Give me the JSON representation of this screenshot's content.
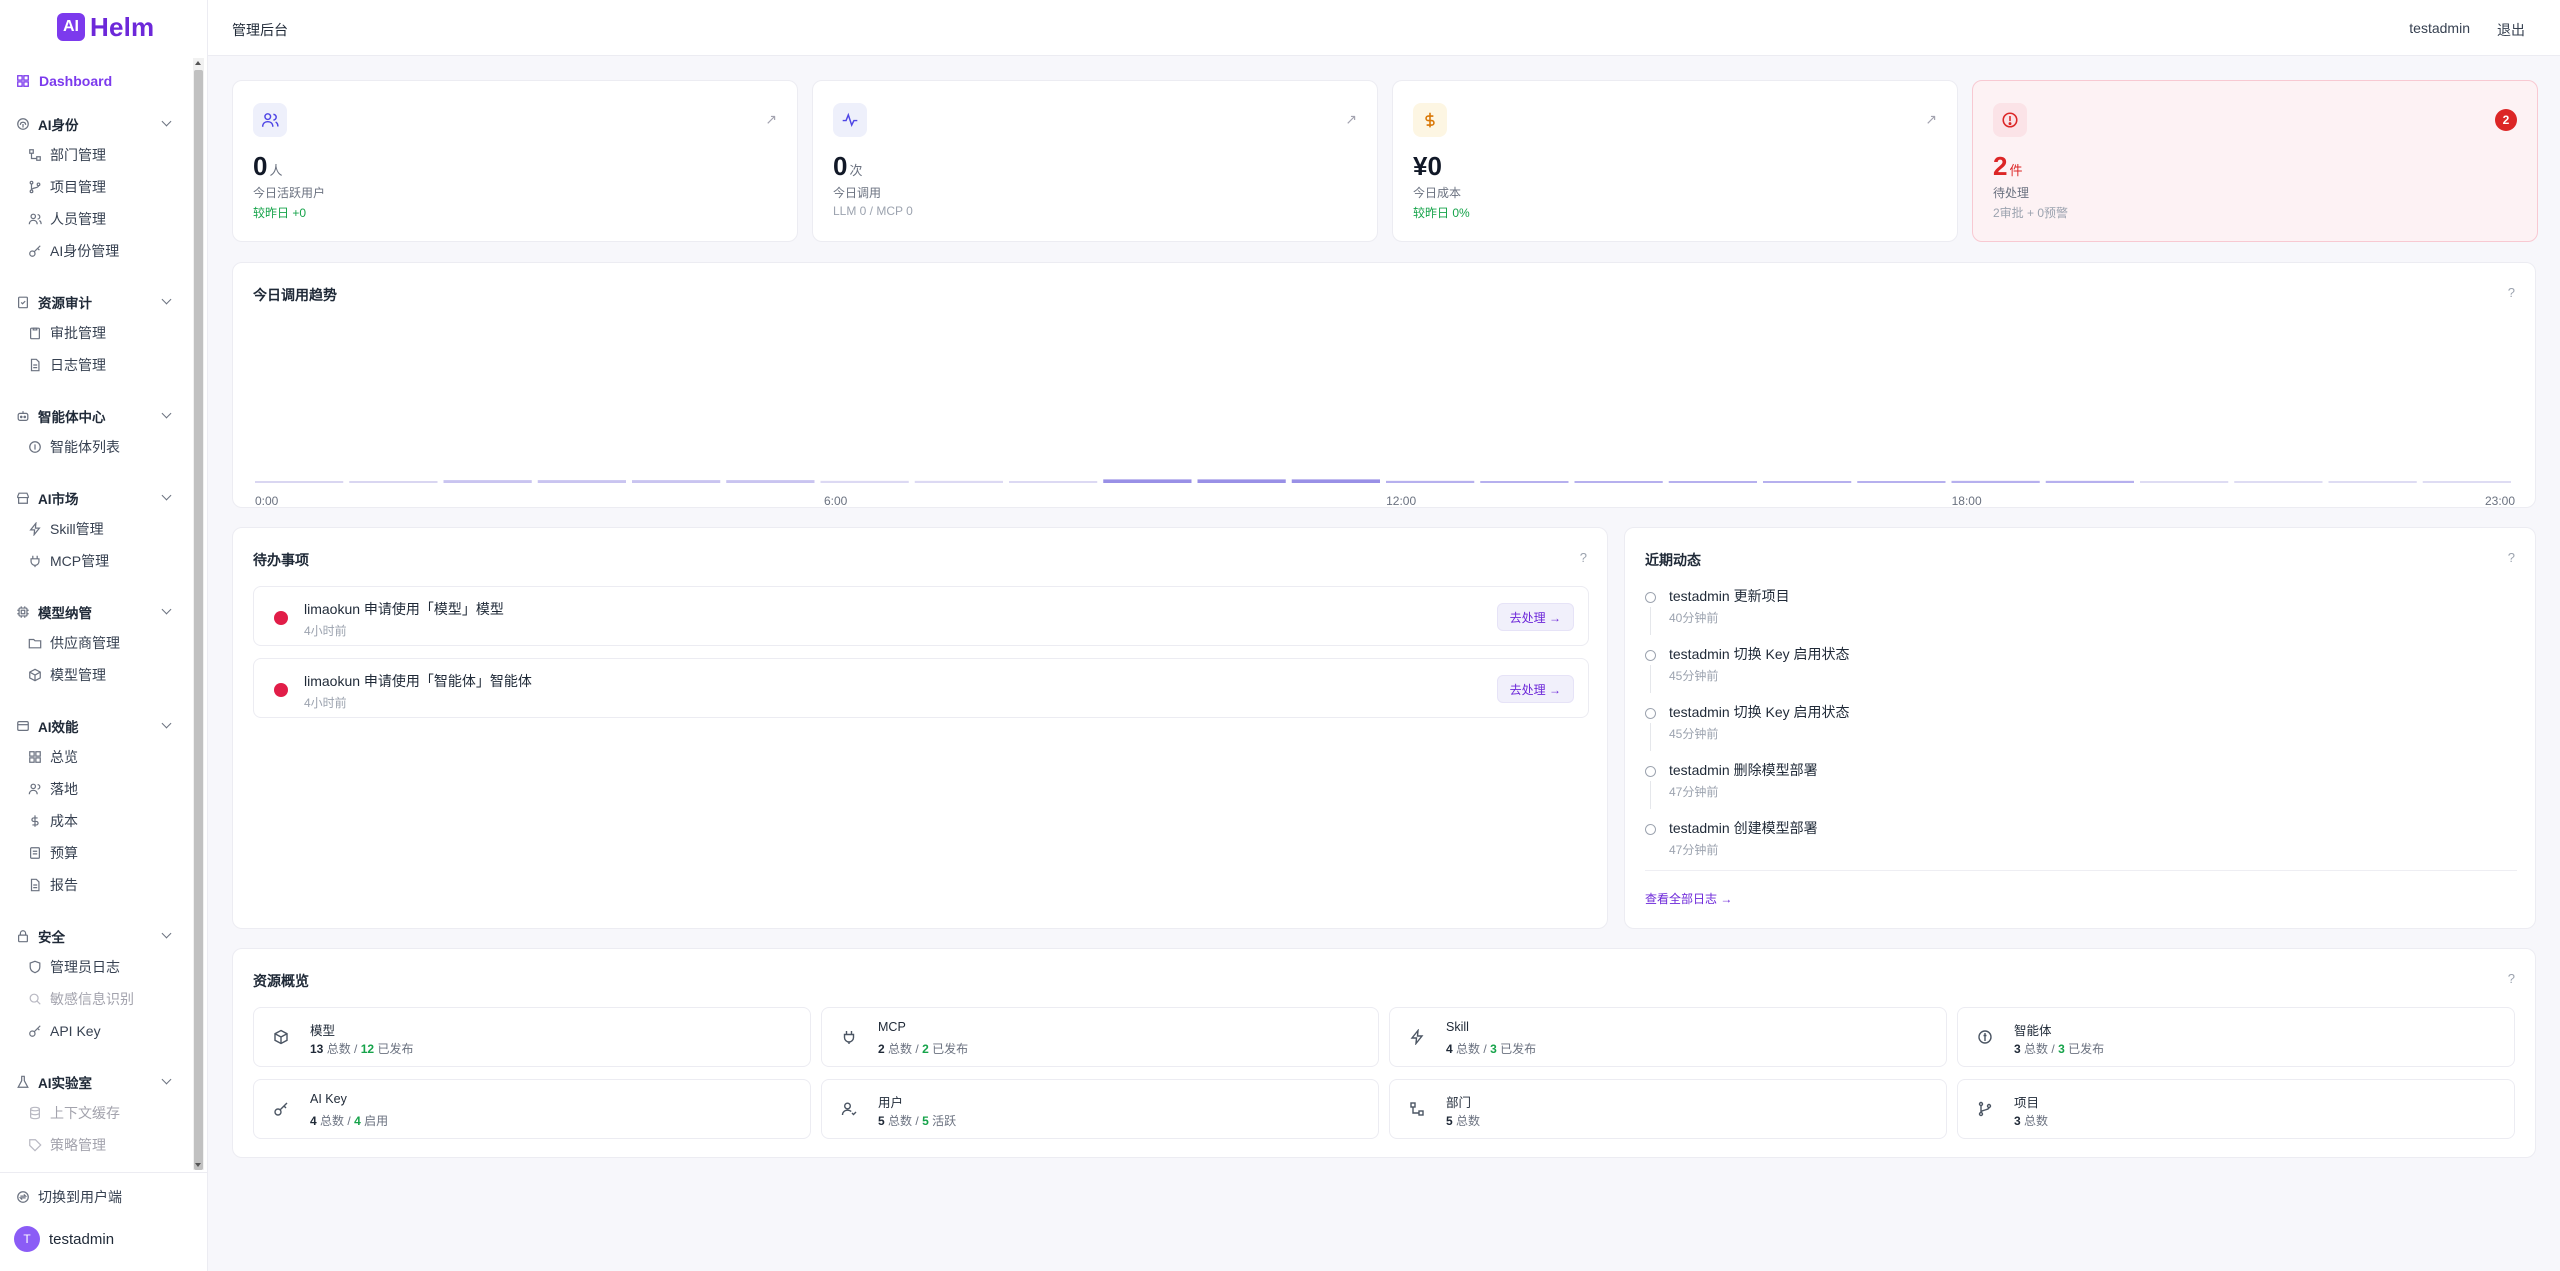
{
  "app": {
    "logo_text": "AI",
    "name": "Helm"
  },
  "header": {
    "title": "管理后台",
    "user": "testadmin",
    "logout": "退出"
  },
  "sidebar": {
    "dashboard": "Dashboard",
    "groups": [
      {
        "title": "AI身份",
        "items": [
          "部门管理",
          "项目管理",
          "人员管理",
          "AI身份管理"
        ]
      },
      {
        "title": "资源审计",
        "items": [
          "审批管理",
          "日志管理"
        ]
      },
      {
        "title": "智能体中心",
        "items": [
          "智能体列表"
        ]
      },
      {
        "title": "AI市场",
        "items": [
          "Skill管理",
          "MCP管理"
        ]
      },
      {
        "title": "模型纳管",
        "items": [
          "供应商管理",
          "模型管理"
        ]
      },
      {
        "title": "AI效能",
        "items": [
          "总览",
          "落地",
          "成本",
          "预算",
          "报告"
        ]
      },
      {
        "title": "安全",
        "items": [
          "管理员日志",
          "敏感信息识别",
          "API Key"
        ]
      },
      {
        "title": "AI实验室",
        "items": [
          "上下文缓存",
          "策略管理"
        ]
      }
    ],
    "switch_user": "切换到用户端",
    "current_user": "testadmin",
    "avatar_letter": "T"
  },
  "stats": [
    {
      "value": "0",
      "unit": "人",
      "label": "今日活跃用户",
      "sub": "较昨日 +0",
      "icon": "users-icon"
    },
    {
      "value": "0",
      "unit": "次",
      "label": "今日调用",
      "sub": "LLM 0 / MCP 0",
      "icon": "activity-icon"
    },
    {
      "value": "¥0",
      "unit": "",
      "label": "今日成本",
      "sub": "较昨日 0%",
      "icon": "dollar-icon"
    },
    {
      "value": "2",
      "unit": "件",
      "label": "待处理",
      "sub": "2审批 + 0预警",
      "badge": "2",
      "icon": "alert-icon"
    }
  ],
  "trend": {
    "title": "今日调用趋势",
    "help": "?"
  },
  "chart_data": {
    "type": "bar",
    "title": "今日调用趋势",
    "categories": [
      "0:00",
      "1:00",
      "2:00",
      "3:00",
      "4:00",
      "5:00",
      "6:00",
      "7:00",
      "8:00",
      "9:00",
      "10:00",
      "11:00",
      "12:00",
      "13:00",
      "14:00",
      "15:00",
      "16:00",
      "17:00",
      "18:00",
      "19:00",
      "20:00",
      "21:00",
      "22:00",
      "23:00"
    ],
    "tick_labels": [
      "0:00",
      "6:00",
      "12:00",
      "18:00",
      "23:00"
    ],
    "values": [
      0.3,
      0.5,
      0.8,
      0.8,
      0.8,
      0.8,
      0.6,
      0.6,
      0.5,
      1.0,
      1.0,
      1.0,
      0.6,
      0.5,
      0.5,
      0.5,
      0.5,
      0.5,
      0.6,
      0.6,
      0.5,
      0.3,
      0.3,
      0.3
    ],
    "ylim": [
      0,
      100
    ],
    "grid": false,
    "colors": [
      "#d6d3f2",
      "#c4bff0",
      "#ddd9f5",
      "#e2e0f3",
      "#a9a2ea",
      "#8f86e4",
      "#b4aeea"
    ]
  },
  "todo": {
    "title": "待办事项",
    "help": "?",
    "items": [
      {
        "title": "limaokun 申请使用「模型」模型",
        "time": "4小时前",
        "action": "去处理 →"
      },
      {
        "title": "limaokun 申请使用「智能体」智能体",
        "time": "4小时前",
        "action": "去处理 →"
      }
    ]
  },
  "recent": {
    "title": "近期动态",
    "help": "?",
    "items": [
      {
        "title": "testadmin 更新项目",
        "time": "40分钟前"
      },
      {
        "title": "testadmin 切换 Key 启用状态",
        "time": "45分钟前"
      },
      {
        "title": "testadmin 切换 Key 启用状态",
        "time": "45分钟前"
      },
      {
        "title": "testadmin 删除模型部署",
        "time": "47分钟前"
      },
      {
        "title": "testadmin 创建模型部署",
        "time": "47分钟前"
      }
    ],
    "view_all": "查看全部日志 →"
  },
  "resources": {
    "title": "资源概览",
    "help": "?",
    "items": [
      {
        "name": "模型",
        "a": "13",
        "a_label": "总数",
        "b": "12",
        "b_label": "已发布",
        "icon": "cube-icon"
      },
      {
        "name": "MCP",
        "a": "2",
        "a_label": "总数",
        "b": "2",
        "b_label": "已发布",
        "icon": "plug-icon"
      },
      {
        "name": "Skill",
        "a": "4",
        "a_label": "总数",
        "b": "3",
        "b_label": "已发布",
        "icon": "bolt-icon"
      },
      {
        "name": "智能体",
        "a": "3",
        "a_label": "总数",
        "b": "3",
        "b_label": "已发布",
        "icon": "bot-icon"
      },
      {
        "name": "AI Key",
        "a": "4",
        "a_label": "总数",
        "b": "4",
        "b_label": "启用",
        "icon": "key-icon"
      },
      {
        "name": "用户",
        "a": "5",
        "a_label": "总数",
        "b": "5",
        "b_label": "活跃",
        "icon": "user-icon"
      },
      {
        "name": "部门",
        "a": "5",
        "a_label": "总数",
        "icon": "org-icon"
      },
      {
        "name": "项目",
        "a": "3",
        "a_label": "总数",
        "icon": "branch-icon"
      }
    ]
  },
  "colors": {
    "accent": "#7c3aed",
    "danger": "#dc2626",
    "success": "#16a34a"
  }
}
